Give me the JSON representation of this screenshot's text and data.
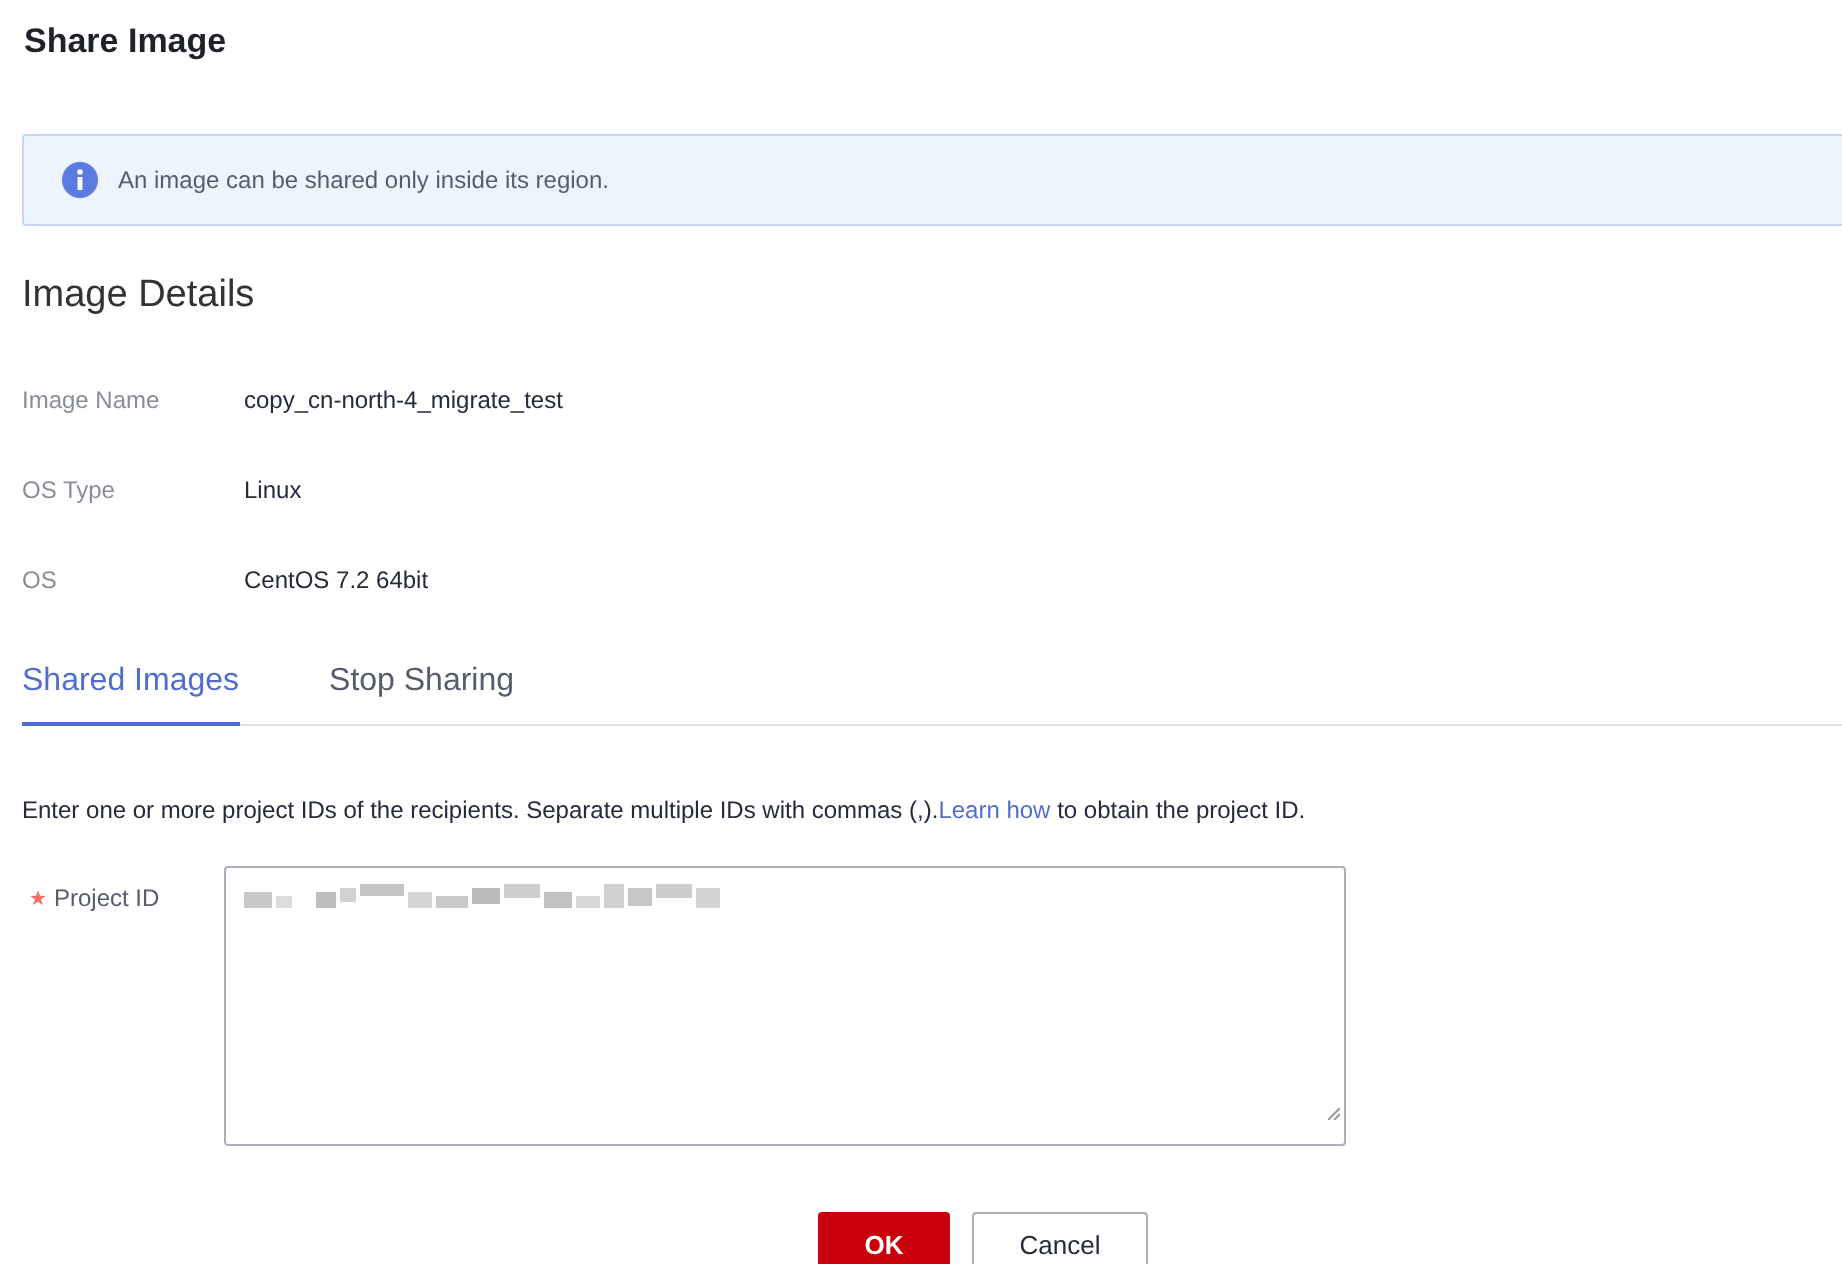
{
  "dialog": {
    "title": "Share Image"
  },
  "notice": {
    "text": "An image can be shared only inside its region."
  },
  "details": {
    "heading": "Image Details",
    "rows": [
      {
        "label": "Image Name",
        "value": "copy_cn-north-4_migrate_test"
      },
      {
        "label": "OS Type",
        "value": "Linux"
      },
      {
        "label": "OS",
        "value": "CentOS 7.2 64bit"
      }
    ]
  },
  "tabs": [
    {
      "label": "Shared Images",
      "selected": true
    },
    {
      "label": "Stop Sharing",
      "selected": false
    }
  ],
  "instruction": {
    "before": "Enter one or more project IDs of the recipients. Separate multiple IDs with commas (,).",
    "link": "Learn how",
    "after": " to obtain the project ID."
  },
  "project_id": {
    "label": "Project ID",
    "required": true,
    "value_redacted": true
  },
  "buttons": [
    {
      "label": "OK",
      "kind": "primary"
    },
    {
      "label": "Cancel",
      "kind": "secondary"
    }
  ]
}
